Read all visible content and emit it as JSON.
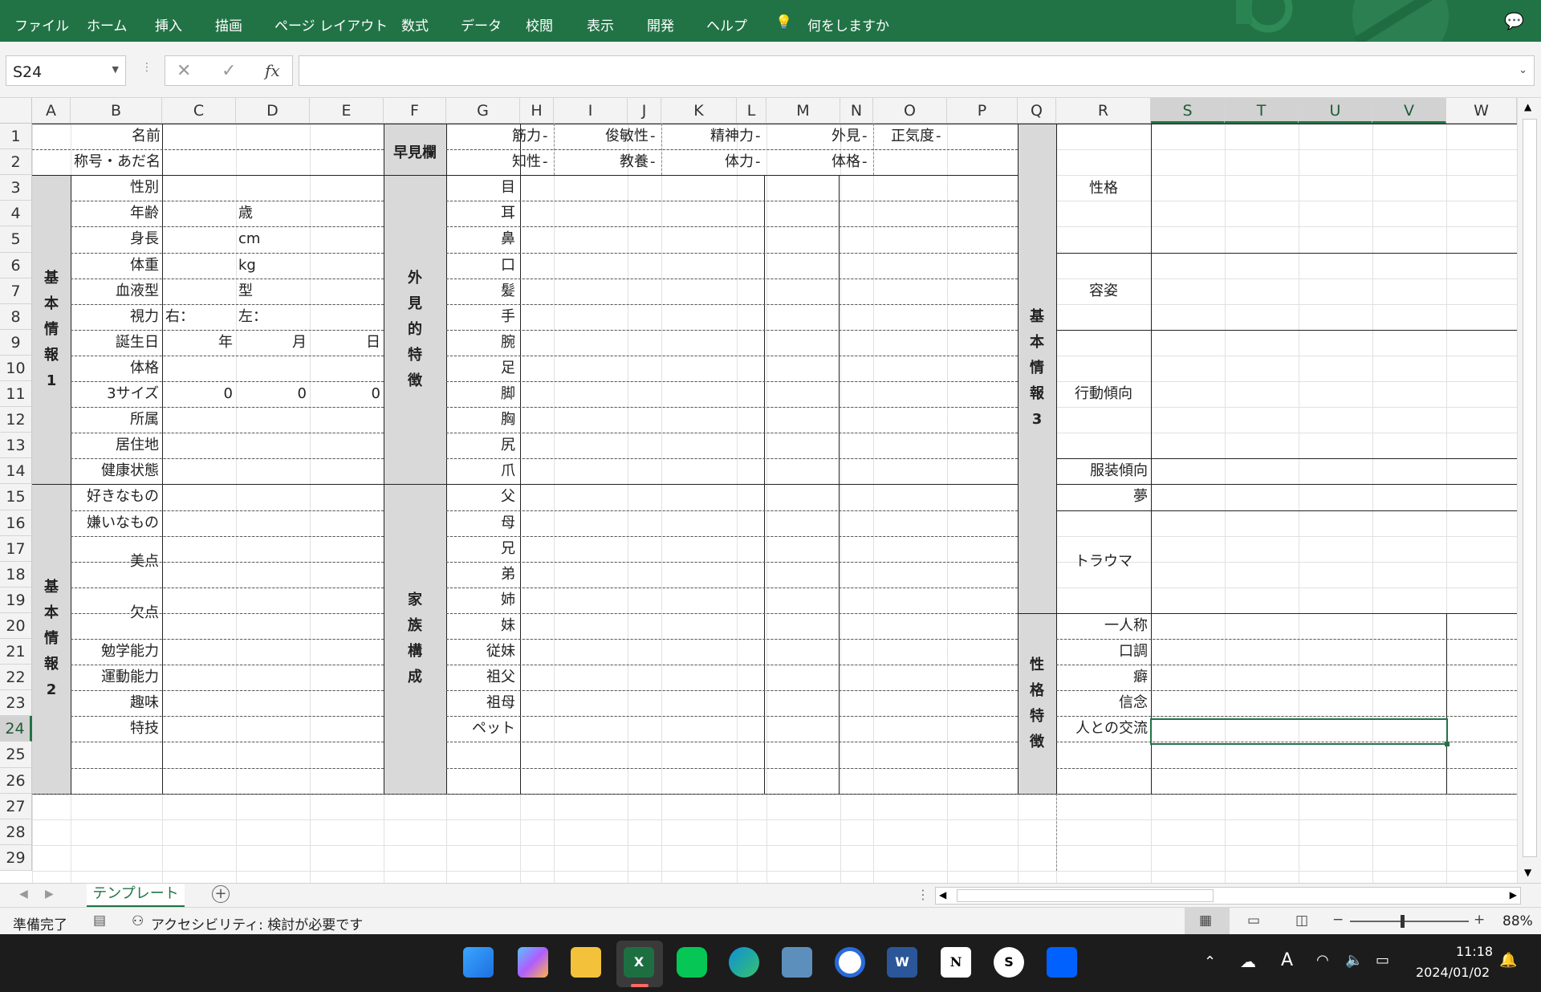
{
  "ribbon": {
    "tabs": [
      "ファイル",
      "ホーム",
      "挿入",
      "描画",
      "ページ レイアウト",
      "数式",
      "データ",
      "校閲",
      "表示",
      "開発",
      "ヘルプ"
    ],
    "tell_me": "何をしますか"
  },
  "formula_bar": {
    "name_box": "S24",
    "cancel": "✕",
    "enter": "✓",
    "fx": "fx",
    "content": ""
  },
  "columns": [
    "A",
    "B",
    "C",
    "D",
    "E",
    "F",
    "G",
    "H",
    "I",
    "J",
    "K",
    "L",
    "M",
    "N",
    "O",
    "P",
    "Q",
    "R",
    "S",
    "T",
    "U",
    "V",
    "W"
  ],
  "rows": [
    "1",
    "2",
    "3",
    "4",
    "5",
    "6",
    "7",
    "8",
    "9",
    "10",
    "11",
    "12",
    "13",
    "14",
    "15",
    "16",
    "17",
    "18",
    "19",
    "20",
    "21",
    "22",
    "23",
    "24",
    "25",
    "26",
    "27",
    "28",
    "29"
  ],
  "section1": {
    "name": "名前",
    "nickname": "称号・あだ名",
    "gender": "性別",
    "age": "年齢",
    "age_unit": "歳",
    "height": "身長",
    "height_unit": "cm",
    "weight": "体重",
    "weight_unit": "kg",
    "blood": "血液型",
    "blood_unit": "型",
    "vision": "視力",
    "vision_right": "右：",
    "vision_left": "左：",
    "birthday": "誕生日",
    "year": "年",
    "month": "月",
    "day": "日",
    "build": "体格",
    "sizes": "3サイズ",
    "size1": "0",
    "size2": "0",
    "size3": "0",
    "affiliation": "所属",
    "residence": "居住地",
    "health": "健康状態",
    "vertical": [
      "基",
      "本",
      "情",
      "報",
      "1"
    ]
  },
  "section2": {
    "likes": "好きなもの",
    "dislikes": "嫌いなもの",
    "strengths": "美点",
    "flaws": "欠点",
    "study": "勉学能力",
    "sports": "運動能力",
    "hobby": "趣味",
    "skill": "特技",
    "vertical": [
      "基",
      "本",
      "情",
      "報",
      "2"
    ]
  },
  "quick": {
    "title": "早見欄",
    "stats_row1": [
      "筋力",
      "俊敏性",
      "精神力",
      "外見",
      "正気度"
    ],
    "stats_row2": [
      "知性",
      "教養",
      "体力",
      "体格"
    ],
    "dash": "-"
  },
  "appearance": {
    "vertical": [
      "外",
      "見",
      "的",
      "特",
      "徴"
    ],
    "parts": [
      "目",
      "耳",
      "鼻",
      "口",
      "髪",
      "手",
      "腕",
      "足",
      "脚",
      "胸",
      "尻",
      "爪"
    ]
  },
  "family": {
    "vertical": [
      "家",
      "族",
      "構",
      "成"
    ],
    "members": [
      "父",
      "母",
      "兄",
      "弟",
      "姉",
      "妹",
      "従妹",
      "祖父",
      "祖母",
      "ペット"
    ]
  },
  "section3": {
    "vertical": [
      "基",
      "本",
      "情",
      "報",
      "3"
    ],
    "personality": "性格",
    "looks": "容姿",
    "behavior": "行動傾向",
    "clothing": "服装傾向",
    "dream": "夢",
    "trauma": "トラウマ"
  },
  "traits": {
    "vertical": [
      "性",
      "格",
      "特",
      "徴"
    ],
    "first_person": "一人称",
    "tone": "口調",
    "habit": "癖",
    "belief": "信念",
    "social": "人との交流"
  },
  "sheet_tab": "テンプレート",
  "status": {
    "ready": "準備完了",
    "accessibility": "アクセシビリティ: 検討が必要です",
    "zoom": "88%"
  },
  "taskbar": {
    "time": "11:18",
    "date": "2024/01/02"
  }
}
